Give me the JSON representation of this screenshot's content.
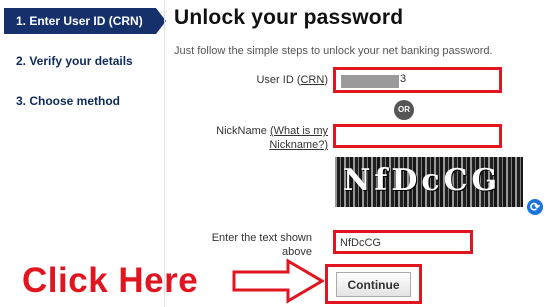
{
  "steps": [
    {
      "label": "1. Enter User ID (CRN)",
      "active": true
    },
    {
      "label": "2. Verify your details",
      "active": false
    },
    {
      "label": "3. Choose method",
      "active": false
    }
  ],
  "title": "Unlock your password",
  "subtitle": "Just follow the simple steps to unlock your net banking password.",
  "userid": {
    "label_prefix": "User ID (",
    "label_link": "CRN",
    "label_suffix": ")",
    "value_visible_tail": "3"
  },
  "or_label": "OR",
  "nickname": {
    "label_prefix": "NickName ",
    "label_link": "(What is my Nickname?)",
    "value": ""
  },
  "captcha": {
    "image_text": "NfDcCG",
    "refresh_icon": "refresh-icon"
  },
  "captcha_input": {
    "label": "Enter the text shown above",
    "value": "NfDcCG"
  },
  "continue_label": "Continue",
  "annotation": {
    "text": "Click Here",
    "color": "#e01520"
  },
  "colors": {
    "active_step": "#16306b",
    "highlight": "#e01520"
  }
}
